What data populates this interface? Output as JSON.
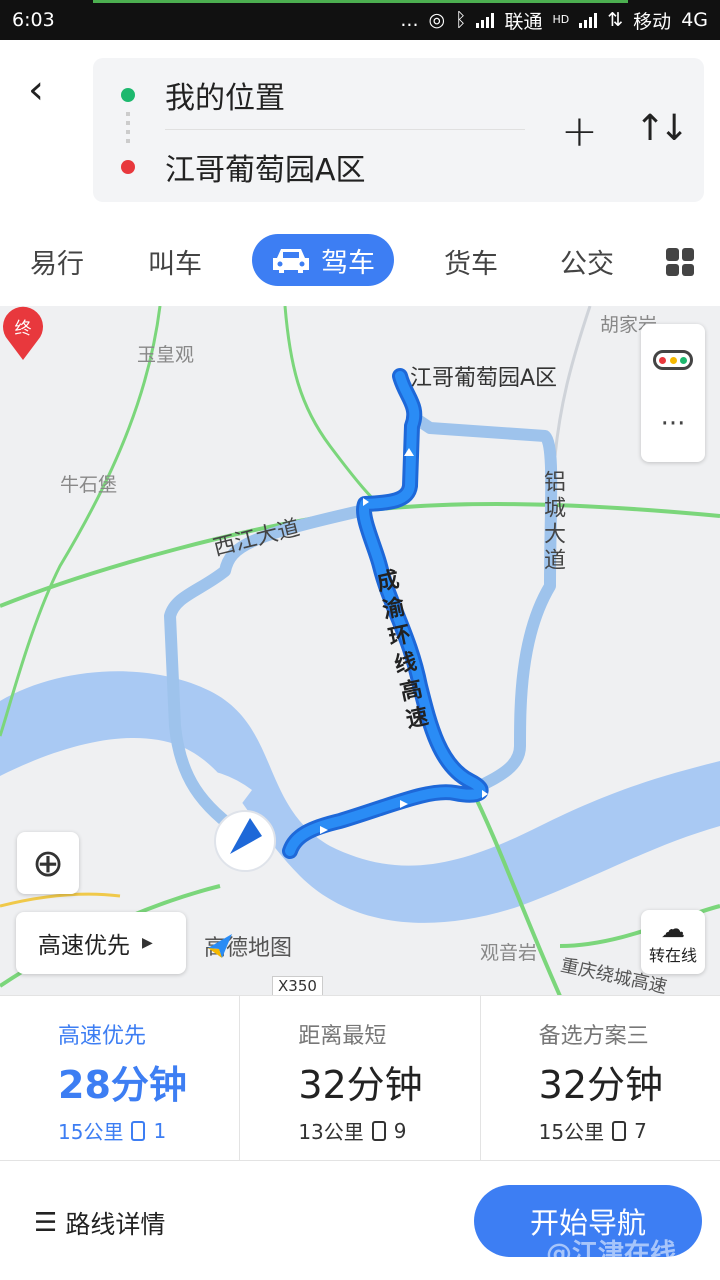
{
  "status_bar": {
    "time": "6:03",
    "carrier1": "联通",
    "carrier2": "移动",
    "network": "4G",
    "hd": "HD",
    "more": "..."
  },
  "route_input": {
    "origin": "我的位置",
    "destination": "江哥葡萄园A区"
  },
  "tabs": [
    {
      "label": "易行"
    },
    {
      "label": "叫车"
    },
    {
      "label": "驾车"
    },
    {
      "label": "货车"
    },
    {
      "label": "公交"
    }
  ],
  "map": {
    "labels": [
      "玉皇观",
      "牛石堡",
      "胡家岩",
      "观音岩",
      "西江大道",
      "铝城大道",
      "成渝环线高速",
      "重庆绕城高速",
      "X350"
    ],
    "end_pin": "终",
    "end_name": "江哥葡萄园A区",
    "brand": "高德地图",
    "preference": "高速优先",
    "online_label": "转在线"
  },
  "routes": [
    {
      "label": "高速优先",
      "time": "28分钟",
      "distance": "15公里",
      "lights": "1",
      "selected": true
    },
    {
      "label": "距离最短",
      "time": "32分钟",
      "distance": "13公里",
      "lights": "9",
      "selected": false
    },
    {
      "label": "备选方案三",
      "time": "32分钟",
      "distance": "15公里",
      "lights": "7",
      "selected": false
    }
  ],
  "bottom": {
    "details": "路线详情",
    "start": "开始导航",
    "watermark": "@江津在线"
  },
  "colors": {
    "accent": "#3d7ef3",
    "route_main": "#2a7df0",
    "route_alt": "#9ec3ec",
    "origin_dot": "#1db86e",
    "dest_dot": "#e8383d"
  }
}
